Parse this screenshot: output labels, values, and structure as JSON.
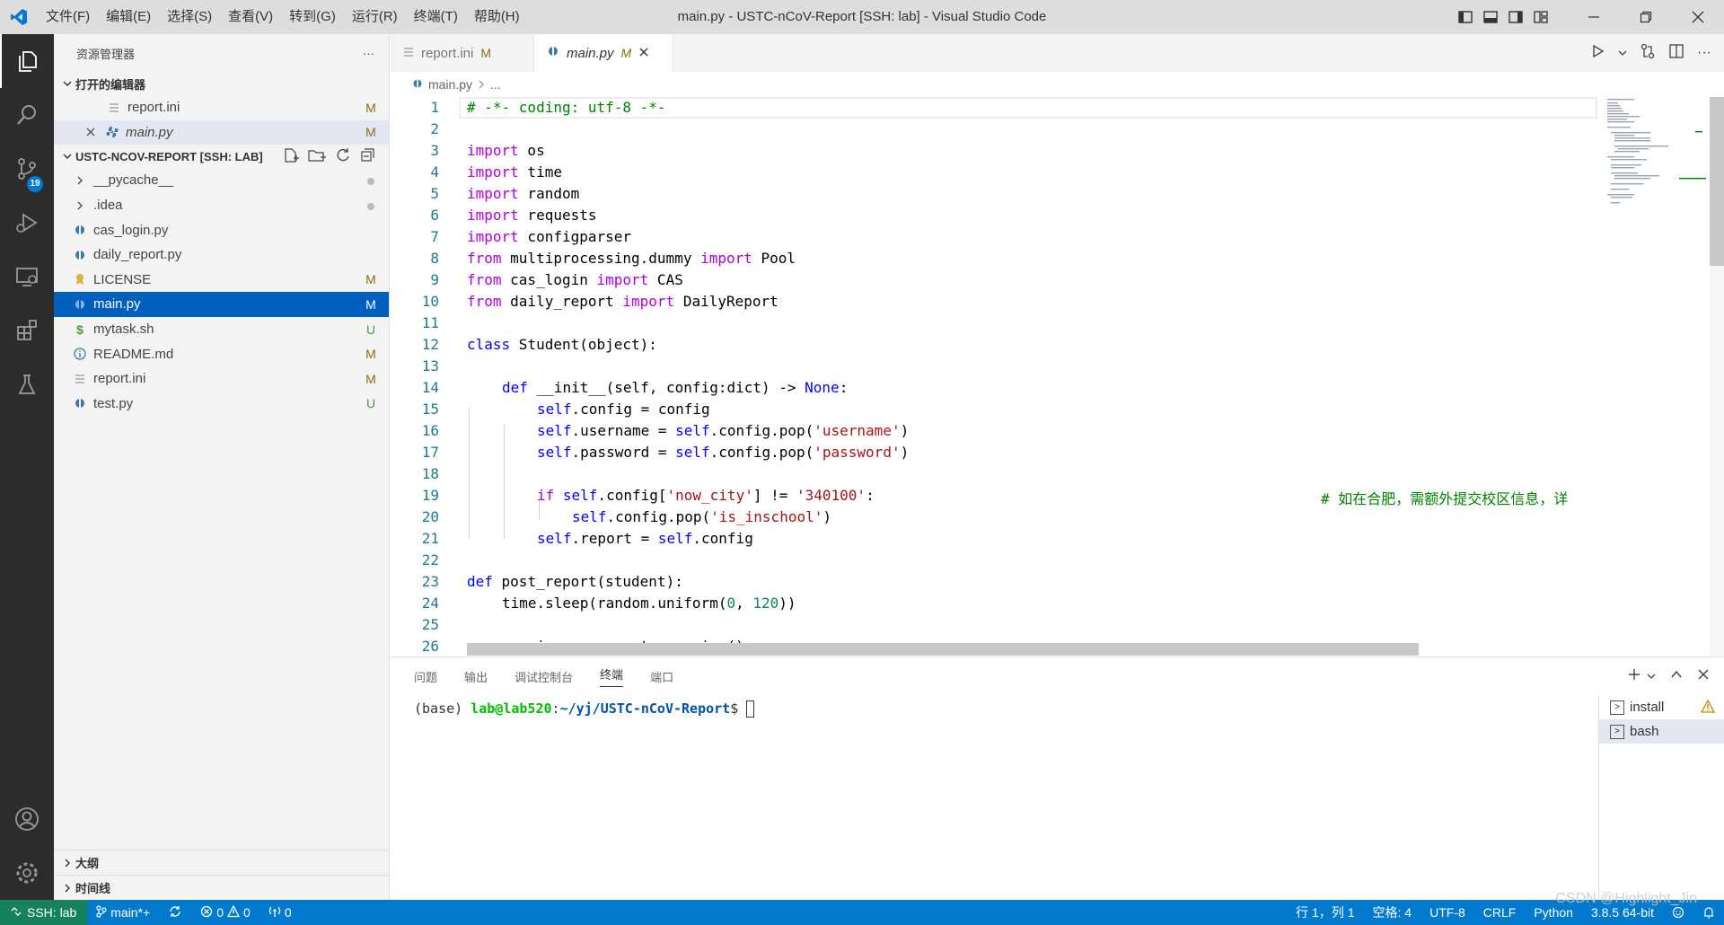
{
  "titlebar": {
    "menu": [
      "文件(F)",
      "编辑(E)",
      "选择(S)",
      "查看(V)",
      "转到(G)",
      "运行(R)",
      "终端(T)",
      "帮助(H)"
    ],
    "title": "main.py - USTC-nCoV-Report [SSH: lab] - Visual Studio Code"
  },
  "activity": {
    "scm_badge": "19"
  },
  "sidebar": {
    "header": "资源管理器",
    "header_more": "···",
    "open_editors_title": "打开的编辑器",
    "open_editors": [
      {
        "name": "report.ini",
        "status": "M"
      },
      {
        "name": "main.py",
        "status": "M"
      }
    ],
    "workspace_title": "USTC-NCOV-REPORT [SSH: LAB]",
    "files": [
      {
        "name": "__pycache__",
        "status": ""
      },
      {
        "name": ".idea",
        "status": ""
      },
      {
        "name": "cas_login.py",
        "status": ""
      },
      {
        "name": "daily_report.py",
        "status": ""
      },
      {
        "name": "LICENSE",
        "status": "M"
      },
      {
        "name": "main.py",
        "status": "M"
      },
      {
        "name": "mytask.sh",
        "status": "U"
      },
      {
        "name": "README.md",
        "status": "M"
      },
      {
        "name": "report.ini",
        "status": "M"
      },
      {
        "name": "test.py",
        "status": "U"
      }
    ],
    "outline_title": "大纲",
    "timeline_title": "时间线"
  },
  "tabs": [
    {
      "name": "report.ini",
      "status": "M"
    },
    {
      "name": "main.py",
      "status": "M"
    }
  ],
  "breadcrumb": {
    "file": "main.py",
    "rest": "..."
  },
  "code": {
    "line_numbers": [
      "1",
      "2",
      "3",
      "4",
      "5",
      "6",
      "7",
      "8",
      "9",
      "10",
      "11",
      "12",
      "13",
      "14",
      "15",
      "16",
      "17",
      "18",
      "19",
      "20",
      "21",
      "22",
      "23",
      "24",
      "25",
      "26"
    ],
    "l1": "# -*- coding: utf-8 -*-",
    "import_kw": "import",
    "from_kw": "from",
    "l3": " os",
    "l4": " time",
    "l5": " random",
    "l6": " requests",
    "l7": " configparser",
    "l8a": " multiprocessing.dummy ",
    "l8b": " Pool",
    "l9a": " cas_login ",
    "l9b": " CAS",
    "l10a": " daily_report ",
    "l10b": " DailyReport",
    "class_kw": "class",
    "l12": " Student(object):",
    "def_kw": "def",
    "l14a": " __init__(self, config:dict) -> ",
    "none_kw": "None",
    "l14b": ":",
    "self_kw": "self",
    "l15": ".config = config",
    "l16a": ".username = ",
    "l16b": ".config.pop(",
    "l16c": "'username'",
    "l16d": ")",
    "l17a": ".password = ",
    "l17b": ".config.pop(",
    "l17c": "'password'",
    "l17d": ")",
    "if_kw": "if",
    "l19a": ".config[",
    "l19b": "'now_city'",
    "l19c": "] != ",
    "l19d": "'340100'",
    "l19e": ":",
    "l19comment": "# 如在合肥，需额外提交校区信息，详",
    "l20a": ".config.pop(",
    "l20b": "'is_inschool'",
    "l20c": ")",
    "l21a": ".report = ",
    "l21b": ".config",
    "l23": " post_report(student):",
    "l24a": "time.sleep(random.uniform(",
    "l24b": "0",
    "l24c": ", ",
    "l24d": "120",
    "l24e": "))",
    "l26": "session = requests.session()"
  },
  "panel": {
    "tabs": [
      "问题",
      "输出",
      "调试控制台",
      "终端",
      "端口"
    ],
    "term_base": "(base) ",
    "term_user": "lab@lab520",
    "term_colon": ":",
    "term_path": "~/yj/USTC-nCoV-Report",
    "term_dollar": "$ ",
    "terminals": [
      "install",
      "bash"
    ]
  },
  "statusbar": {
    "remote": "SSH: lab",
    "branch": "main*+",
    "errors": "0",
    "warnings": "0",
    "ports": "0",
    "position": "行 1，列 1",
    "spaces": "空格: 4",
    "encoding": "UTF-8",
    "eol": "CRLF",
    "language": "Python",
    "interpreter": "3.8.5 64-bit"
  },
  "watermark": "CSDN @Highlight_Jin",
  "colors": {
    "accent": "#007acc",
    "remote": "#16825d",
    "selection": "#0060c0",
    "activitybar": "#2c2c2c"
  }
}
